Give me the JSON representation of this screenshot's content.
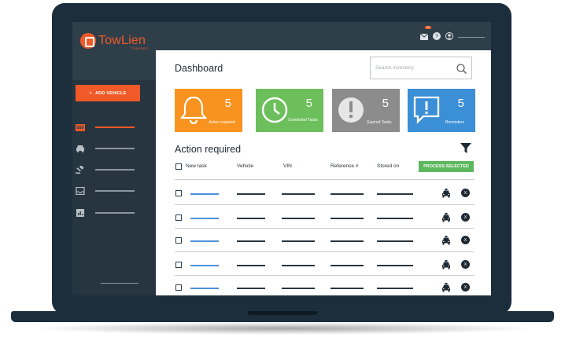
{
  "app": {
    "logo_text": "TowLien",
    "logo_sub": "TRAXERO"
  },
  "sidebar": {
    "add_button_label": "ADD VEHICLE",
    "items": [
      {
        "icon": "calendar-icon",
        "active": true
      },
      {
        "icon": "car-icon",
        "active": false
      },
      {
        "icon": "gavel-icon",
        "active": false
      },
      {
        "icon": "inbox-icon",
        "active": false
      },
      {
        "icon": "report-icon",
        "active": false
      }
    ]
  },
  "topbar": {
    "mail_badge": "12",
    "icons": [
      "mail-icon",
      "help-icon",
      "user-icon"
    ]
  },
  "main": {
    "title": "Dashboard",
    "search_placeholder": "Search inventory",
    "tiles": [
      {
        "count": "5",
        "label": "Action required",
        "color": "#f7931e",
        "icon": "bell-icon"
      },
      {
        "count": "5",
        "label": "Scheduled Tasks",
        "color": "#6cbf5b",
        "icon": "clock-icon"
      },
      {
        "count": "5",
        "label": "Expired Tasks",
        "color": "#8c8c8c",
        "icon": "alert-icon"
      },
      {
        "count": "5",
        "label": "Reminders",
        "color": "#3b8fd6",
        "icon": "message-alert-icon"
      }
    ],
    "section_title": "Action required",
    "columns": [
      "New task",
      "Vehicle",
      "VIN",
      "Reference #",
      "Stored on"
    ],
    "process_button_label": "PROCESS SELECTED",
    "rows": [
      {},
      {},
      {},
      {},
      {}
    ],
    "colors": {
      "accent": "#f05a28",
      "sidebar": "#2f3f4a",
      "link": "#4a90d9",
      "success": "#5cb85c"
    }
  }
}
